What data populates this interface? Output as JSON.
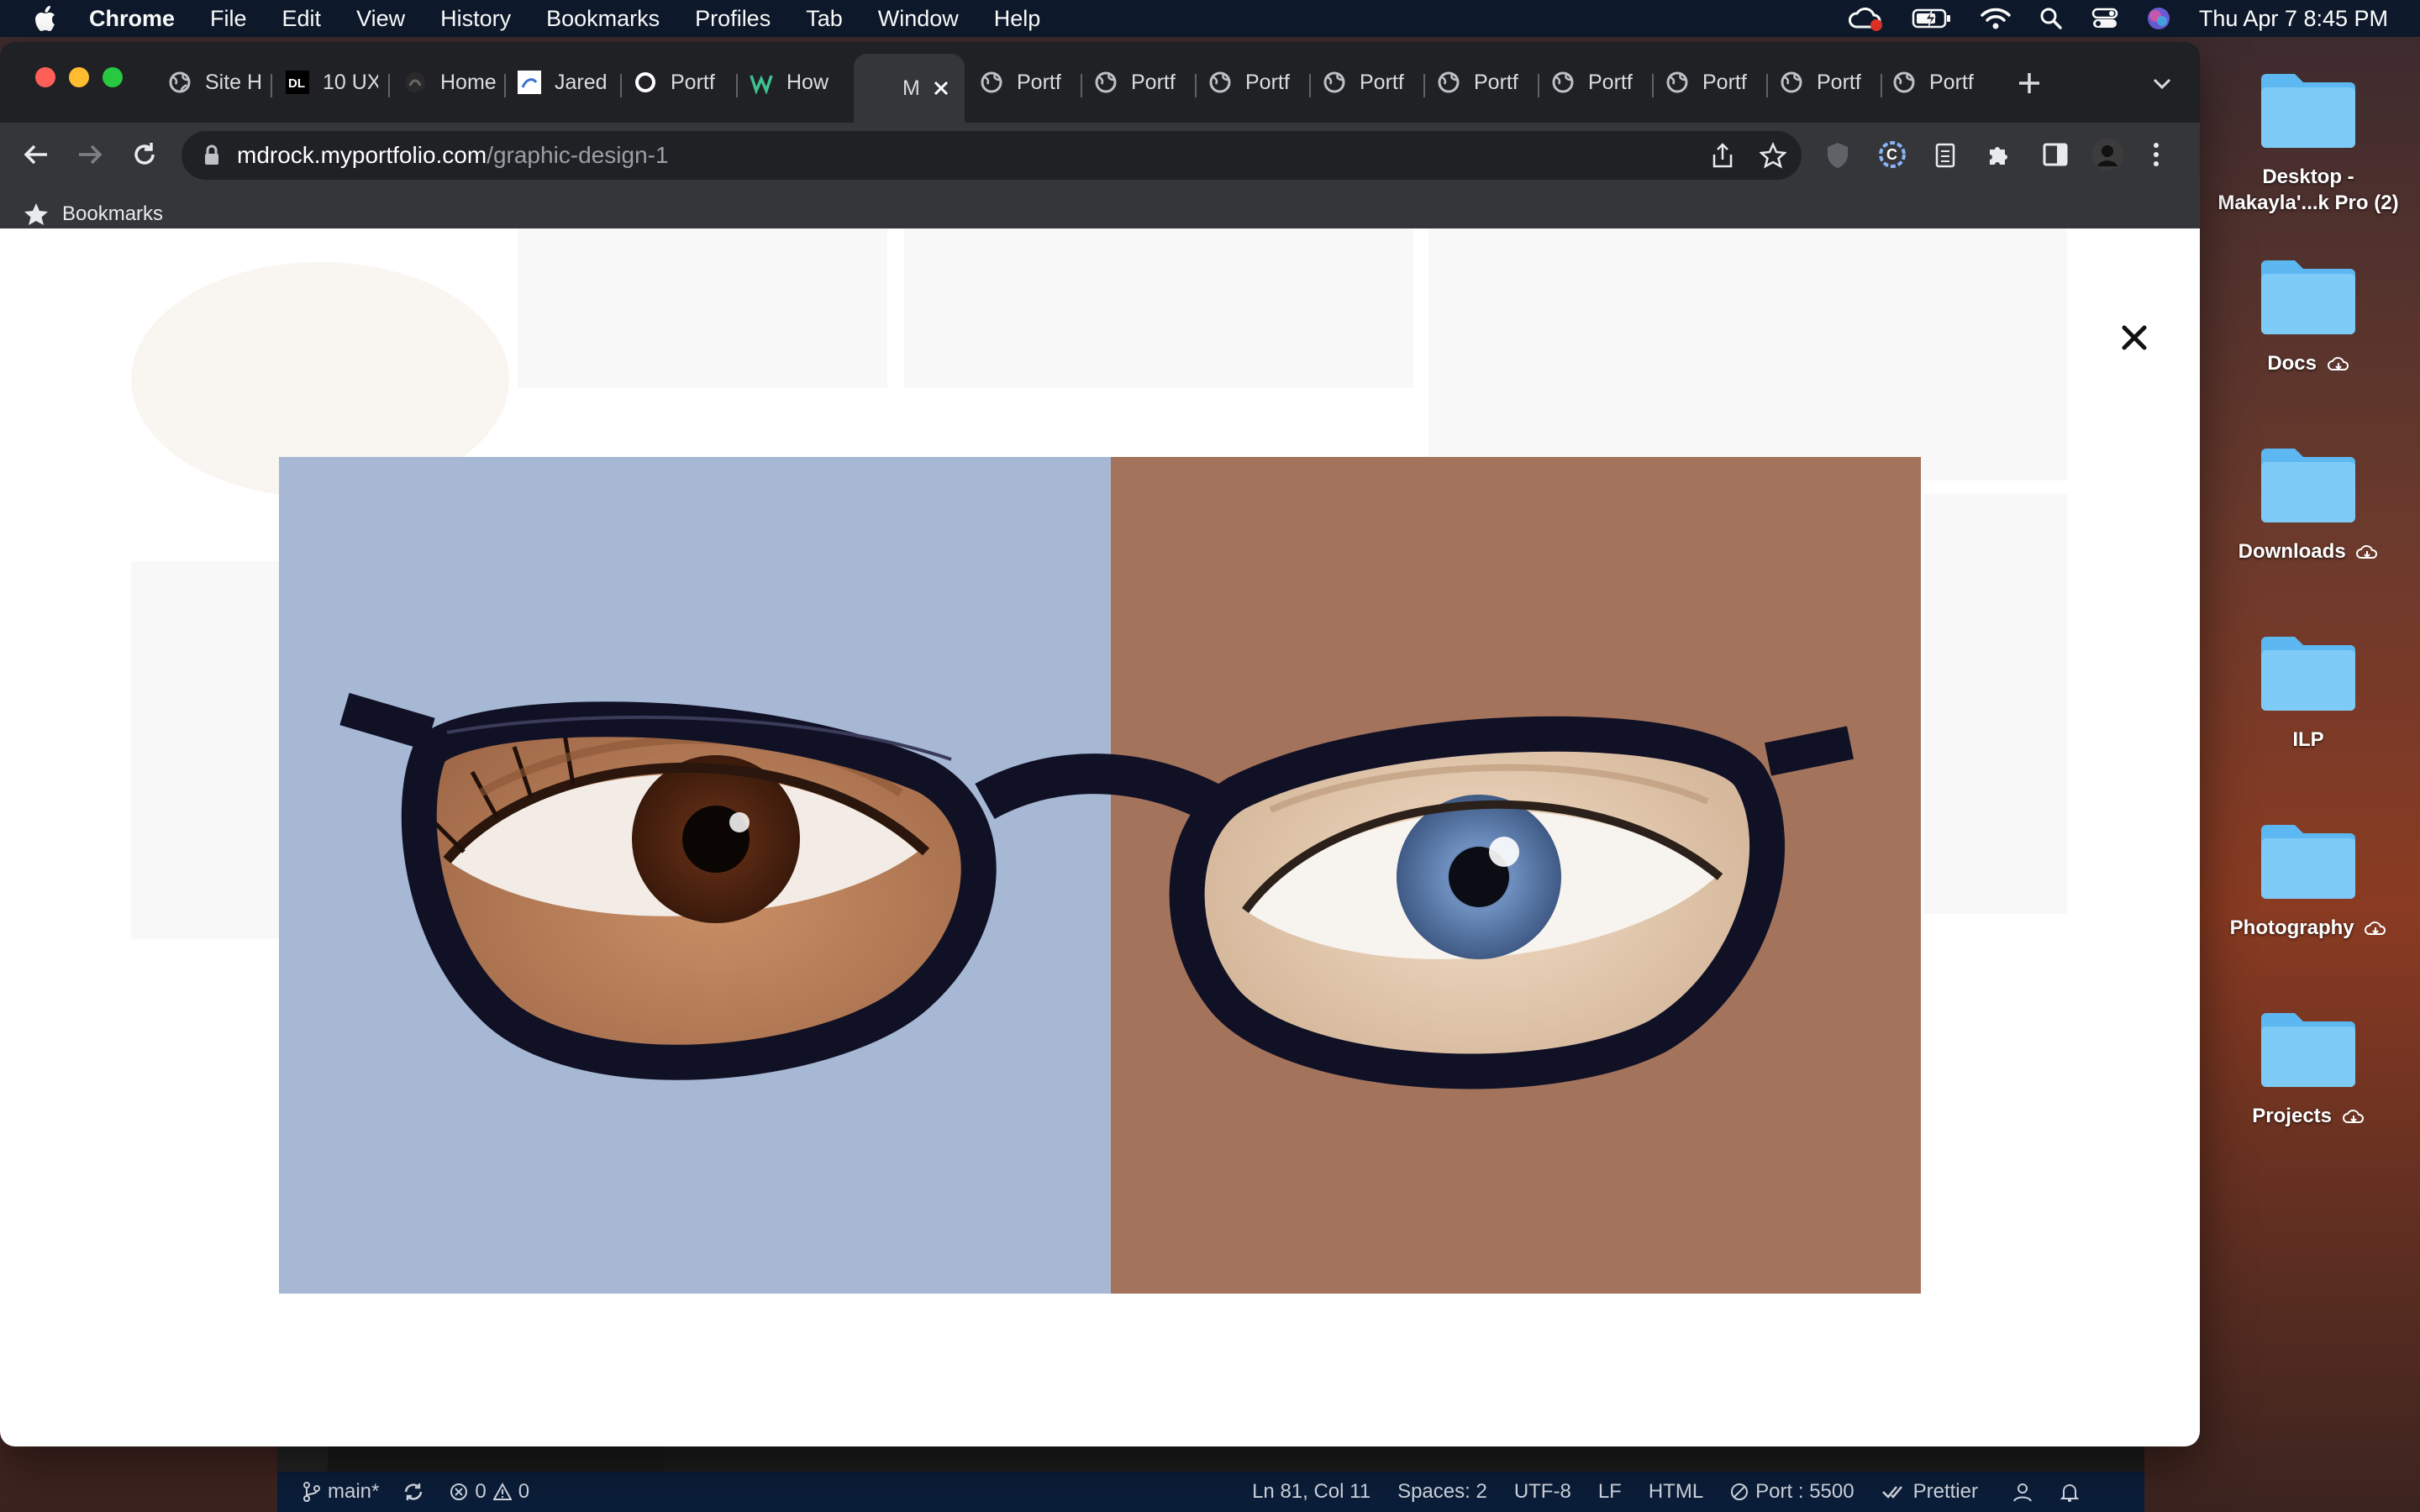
{
  "menubar": {
    "app": "Chrome",
    "items": [
      "File",
      "Edit",
      "View",
      "History",
      "Bookmarks",
      "Profiles",
      "Tab",
      "Window",
      "Help"
    ],
    "clock": "Thu Apr 7  8:45 PM"
  },
  "tabs": [
    {
      "label": "Site H"
    },
    {
      "label": "10 UX"
    },
    {
      "label": "Home"
    },
    {
      "label": "Jared"
    },
    {
      "label": "Portf"
    },
    {
      "label": "How"
    },
    {
      "label": "M"
    },
    {
      "label": "Portf"
    },
    {
      "label": "Portf"
    },
    {
      "label": "Portf"
    },
    {
      "label": "Portf"
    },
    {
      "label": "Portf"
    },
    {
      "label": "Portf"
    },
    {
      "label": "Portf"
    },
    {
      "label": "Portf"
    },
    {
      "label": "Portf"
    }
  ],
  "address": {
    "host": "mdrock.myportfolio.com",
    "path": "/graphic-design-1"
  },
  "bookmarks_label": "Bookmarks",
  "desktop": [
    {
      "label": "Desktop - Makayla'...k Pro (2)",
      "cloud": false
    },
    {
      "label": "Docs",
      "cloud": true
    },
    {
      "label": "Downloads",
      "cloud": true
    },
    {
      "label": "ILP",
      "cloud": false
    },
    {
      "label": "Photography",
      "cloud": true
    },
    {
      "label": "Projects",
      "cloud": true
    }
  ],
  "vscode_status": {
    "branch": "main*",
    "problems": "0",
    "warnings": "0",
    "position": "Ln 81, Col 11",
    "spaces": "Spaces: 2",
    "encoding": "UTF-8",
    "eol": "LF",
    "language": "HTML",
    "port": "Port : 5500",
    "formatter": "Prettier"
  },
  "colors": {
    "left_panel": "#a6b8d4",
    "right_panel": "#a4735c",
    "frame": "#111126"
  }
}
